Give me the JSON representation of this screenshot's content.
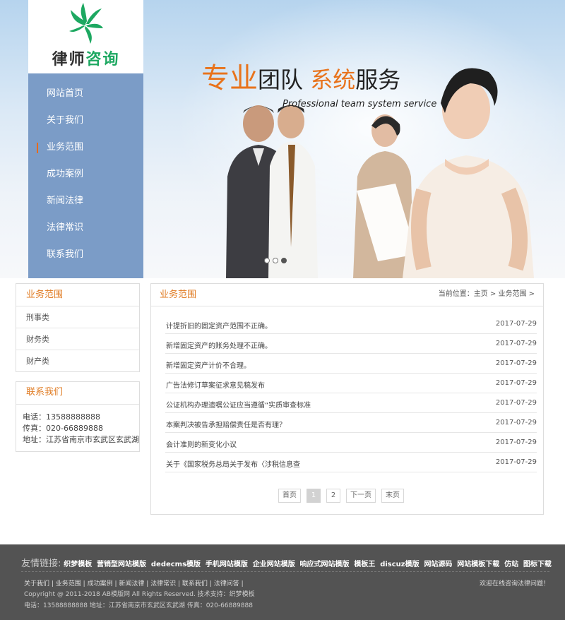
{
  "brand": {
    "name_dark": "律师",
    "name_green": "咨询"
  },
  "nav": [
    {
      "label": "网站首页",
      "active": false
    },
    {
      "label": "关于我们",
      "active": false
    },
    {
      "label": "业务范围",
      "active": true
    },
    {
      "label": "成功案例",
      "active": false
    },
    {
      "label": "新闻法律",
      "active": false
    },
    {
      "label": "法律常识",
      "active": false
    },
    {
      "label": "联系我们",
      "active": false
    }
  ],
  "banner": {
    "slogan_1": "专业",
    "slogan_2": "团队 ",
    "slogan_3": "系统",
    "slogan_4": "服务",
    "slogan_en": "Professional team system service",
    "slides": 3,
    "active_slide": 3
  },
  "left_categories": {
    "title": "业务范围",
    "items": [
      "刑事类",
      "财务类",
      "财产类"
    ]
  },
  "contact": {
    "title": "联系我们",
    "phone": "电话：13588888888",
    "fax": "传真：020-66889888",
    "address": "地址：江苏省南京市玄武区玄武湖"
  },
  "main": {
    "title": "业务范围",
    "breadcrumb": "当前位置：主页 > 业务范围 >",
    "articles": [
      {
        "title": "计提折旧的固定资产范围不正确。",
        "date": "2017-07-29"
      },
      {
        "title": "新增固定资产的账务处理不正确。",
        "date": "2017-07-29"
      },
      {
        "title": "新增固定资产计价不合理。",
        "date": "2017-07-29"
      },
      {
        "title": "广告法修订草案征求意见稿发布",
        "date": "2017-07-29"
      },
      {
        "title": "公证机构办理遗嘱公证应当遵循“实质审查标准",
        "date": "2017-07-29"
      },
      {
        "title": "本案判决被告承担赔偿责任是否有理？",
        "date": "2017-07-29"
      },
      {
        "title": "会计准则的新变化小议",
        "date": "2017-07-29"
      },
      {
        "title": "关于《国家税务总局关于发布〈涉税信息查",
        "date": "2017-07-29"
      }
    ],
    "pager": {
      "first": "首页",
      "p1": "1",
      "p2": "2",
      "next": "下一页",
      "last": "末页"
    }
  },
  "footer": {
    "links_label": "友情链接:",
    "links": [
      "织梦模板",
      "营销型网站模版",
      "dedecms模版",
      "手机网站模版",
      "企业网站模版",
      "响应式网站模版",
      "模板王",
      "discuz模版",
      "网站源码",
      "网站模板下载",
      "仿站",
      "图标下载"
    ],
    "nav": [
      "关于我们",
      "业务范围",
      "成功案例",
      "新闻法律",
      "法律常识",
      "联系我们",
      "法律问答"
    ],
    "welcome": "欢迎在线咨询法律问题！",
    "copyright": "Copyright @ 2011-2018 AB模版网 All Rights Reserved. 技术支持：织梦模板",
    "address": "电话：13588888888 地址：江苏省南京市玄武区玄武湖 传真：020-66889888"
  },
  "colors": {
    "accent_orange": "#e8731c",
    "brand_green": "#1da861",
    "sidebar_blue": "#7b9cc7",
    "footer_gray": "#535353"
  }
}
